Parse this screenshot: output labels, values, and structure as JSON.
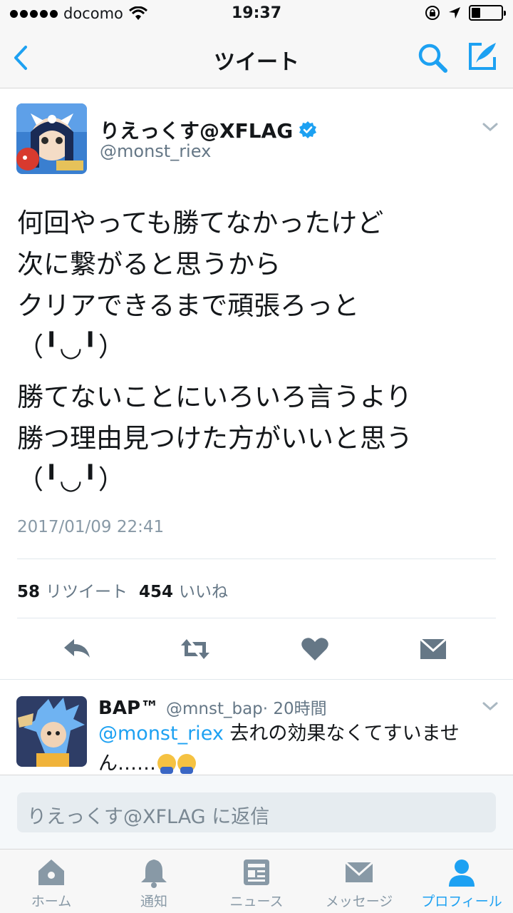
{
  "status_bar": {
    "carrier": "docomo",
    "time": "19:37"
  },
  "nav": {
    "title": "ツイート"
  },
  "tweet": {
    "display_name": "りえっくす@XFLAG",
    "handle": "@monst_riex",
    "lines": [
      "何回やっても勝てなかったけど",
      "次に繋がると思うから",
      "クリアできるまで頑張ろっと",
      "（╹◡╹）",
      "勝てないことにいろいろ言うより",
      "勝つ理由見つけた方がいいと思う",
      "（╹◡╹）"
    ],
    "timestamp": "2017/01/09 22:41",
    "retweet_count": "58",
    "retweet_label": "リツイート",
    "like_count": "454",
    "like_label": "いいね"
  },
  "reply": {
    "display_name": "BAP™",
    "handle": "@mnst_bap",
    "time": "· 20時間",
    "mention": "@monst_riex",
    "text": " 去れの効果なくてすいません……"
  },
  "reply_bar": {
    "placeholder": "りえっくす@XFLAG に返信"
  },
  "tabs": [
    {
      "label": "ホーム",
      "icon": "home-icon"
    },
    {
      "label": "通知",
      "icon": "bell-icon"
    },
    {
      "label": "ニュース",
      "icon": "news-icon"
    },
    {
      "label": "メッセージ",
      "icon": "envelope-icon"
    },
    {
      "label": "プロフィール",
      "icon": "person-icon"
    }
  ],
  "colors": {
    "accent": "#1da1f2",
    "muted": "#657786",
    "verified": "#1da1f2"
  }
}
